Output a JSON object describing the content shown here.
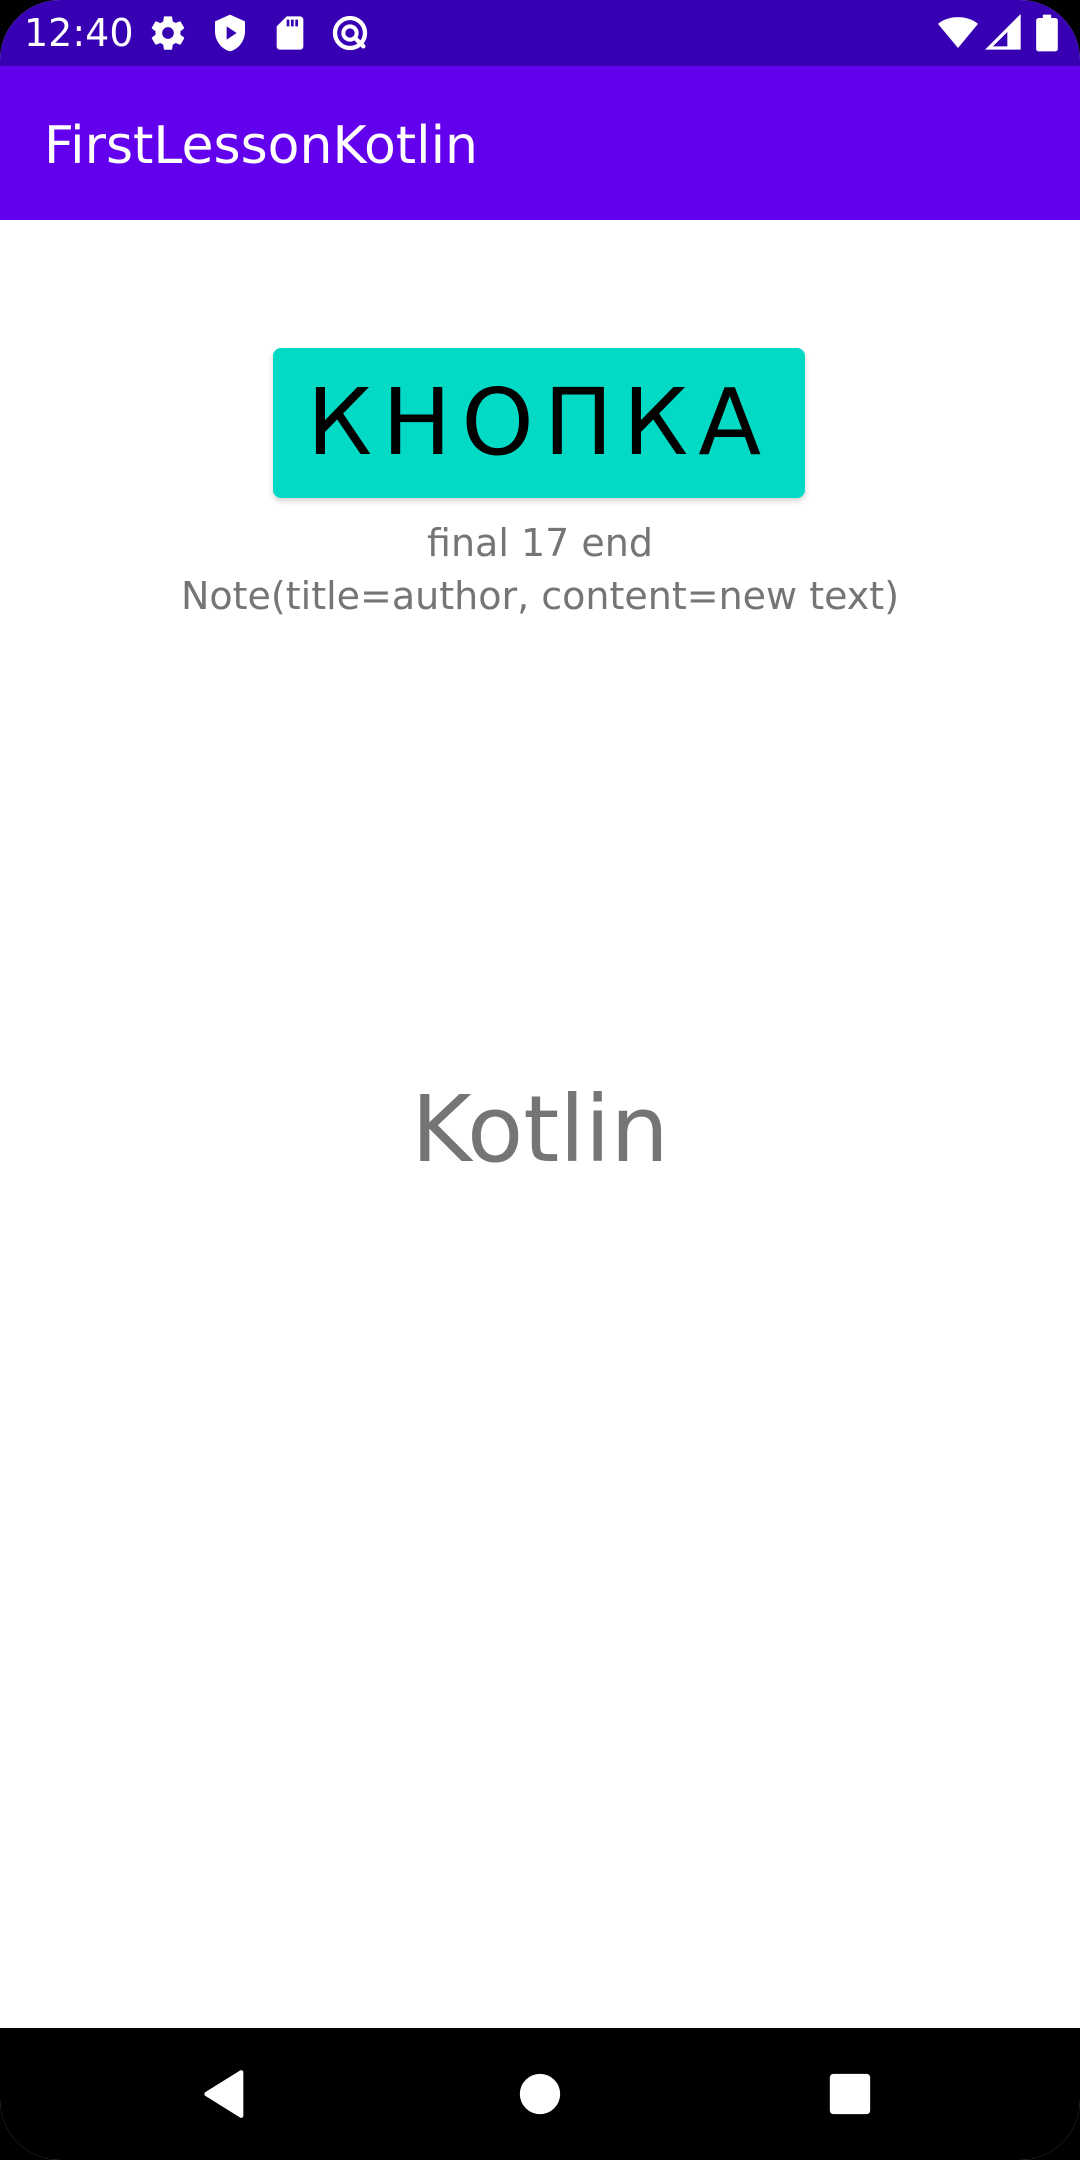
{
  "status_bar": {
    "time": "12:40",
    "left_icons": [
      "settings-icon",
      "play-protect-icon",
      "sd-card-icon",
      "data-saver-icon"
    ],
    "right_icons": [
      "wifi-icon",
      "cell-signal-icon",
      "battery-icon"
    ],
    "background_color": "#3700b3"
  },
  "app_bar": {
    "title": "FirstLessonKotlin",
    "background_color": "#6200ee"
  },
  "main": {
    "button_label": "КНОПКА",
    "button_color": "#03dac5",
    "line1": "final 17 end",
    "line2": "Note(title=author, content=new text)",
    "big_text": "Kotlin",
    "text_color": "#757575"
  },
  "nav_bar": {
    "icons": [
      "back-icon",
      "home-icon",
      "recents-icon"
    ]
  }
}
